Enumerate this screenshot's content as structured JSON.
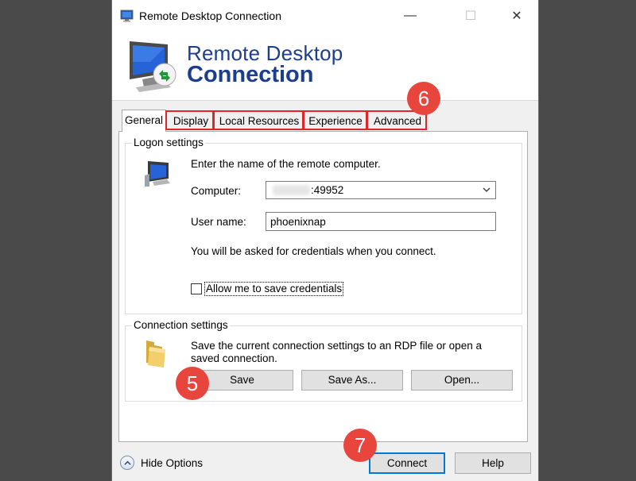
{
  "window": {
    "title": "Remote Desktop Connection",
    "minimize_glyph": "—",
    "maximize_glyph": "☐",
    "close_glyph": "✕"
  },
  "banner": {
    "line1": "Remote Desktop",
    "line2": "Connection"
  },
  "tabs": [
    {
      "label": "General",
      "active": true
    },
    {
      "label": "Display",
      "active": false
    },
    {
      "label": "Local Resources",
      "active": false
    },
    {
      "label": "Experience",
      "active": false
    },
    {
      "label": "Advanced",
      "active": false
    }
  ],
  "logon": {
    "legend": "Logon settings",
    "instruction": "Enter the name of the remote computer.",
    "computer_label": "Computer:",
    "computer_value": ":49952",
    "username_label": "User name:",
    "username_value": "phoenixnap",
    "credentials_note": "You will be asked for credentials when you connect.",
    "save_credentials_label": "Allow me to save credentials",
    "save_credentials_checked": false
  },
  "connection": {
    "legend": "Connection settings",
    "description_line1": "Save the current connection settings to an RDP file or open a",
    "description_line2": "saved connection.",
    "save_label": "Save",
    "save_as_label": "Save As...",
    "open_label": "Open..."
  },
  "footer": {
    "hide_options_label": "Hide Options",
    "connect_label": "Connect",
    "help_label": "Help"
  },
  "annotations": {
    "badge_tabs": "6",
    "badge_save": "5",
    "badge_connect": "7"
  },
  "colors": {
    "brand_blue": "#1c3e8c",
    "annotation_red": "#e8453c",
    "highlight_red": "#e0262a",
    "focus_blue": "#0078d7"
  }
}
